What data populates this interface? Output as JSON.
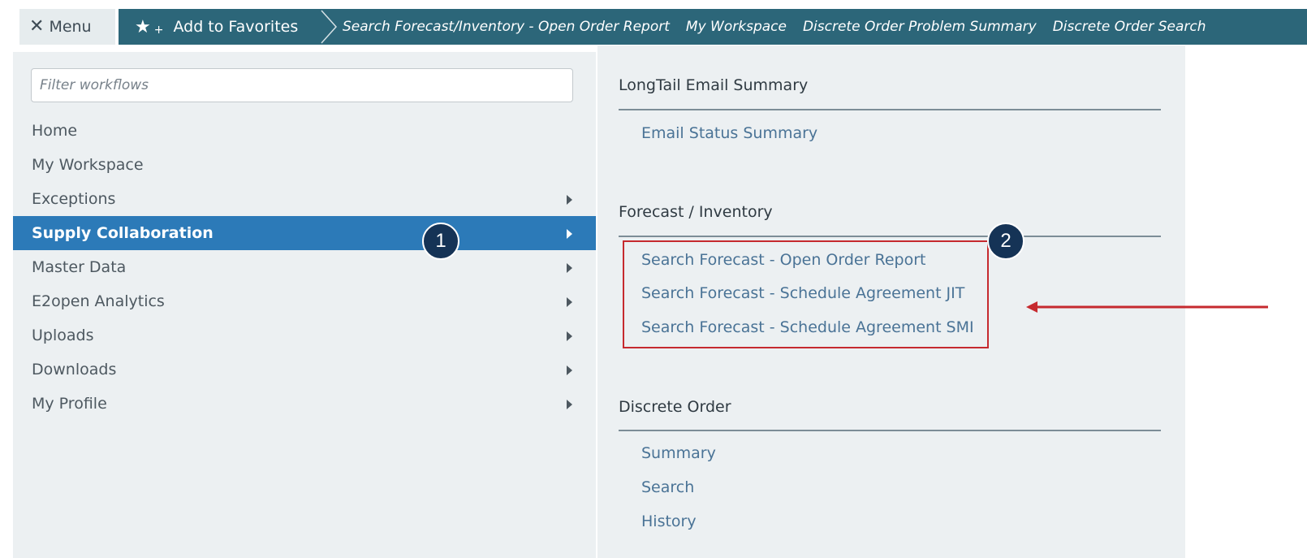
{
  "topbar": {
    "menu_label": "Menu",
    "favorites_label": "Add to Favorites",
    "breadcrumbs": [
      "Search Forecast/Inventory - Open Order Report",
      "My Workspace",
      "Discrete Order Problem Summary",
      "Discrete Order Search"
    ]
  },
  "filter": {
    "placeholder": "Filter workflows"
  },
  "menu": {
    "items": [
      {
        "label": "Home"
      },
      {
        "label": "My Workspace"
      },
      {
        "label": "Exceptions"
      },
      {
        "label": "Supply Collaboration"
      },
      {
        "label": "Master Data"
      },
      {
        "label": "E2open Analytics"
      },
      {
        "label": "Uploads"
      },
      {
        "label": "Downloads"
      },
      {
        "label": "My Profile"
      }
    ]
  },
  "sections": [
    {
      "title": "LongTail Email Summary",
      "links": [
        "Email Status Summary"
      ]
    },
    {
      "title": "Forecast / Inventory",
      "links": [
        "Search Forecast - Open Order Report",
        "Search Forecast - Schedule Agreement JIT",
        "Search Forecast - Schedule Agreement SMI"
      ]
    },
    {
      "title": "Discrete Order",
      "links": [
        "Summary",
        "Search",
        "History"
      ]
    }
  ],
  "annotations": {
    "badge_1": "1",
    "badge_2": "2"
  },
  "colors": {
    "nav_strip": "#2c6679",
    "active_item": "#2c7ab8",
    "highlight": "#c62a2f",
    "badge": "#153356"
  }
}
